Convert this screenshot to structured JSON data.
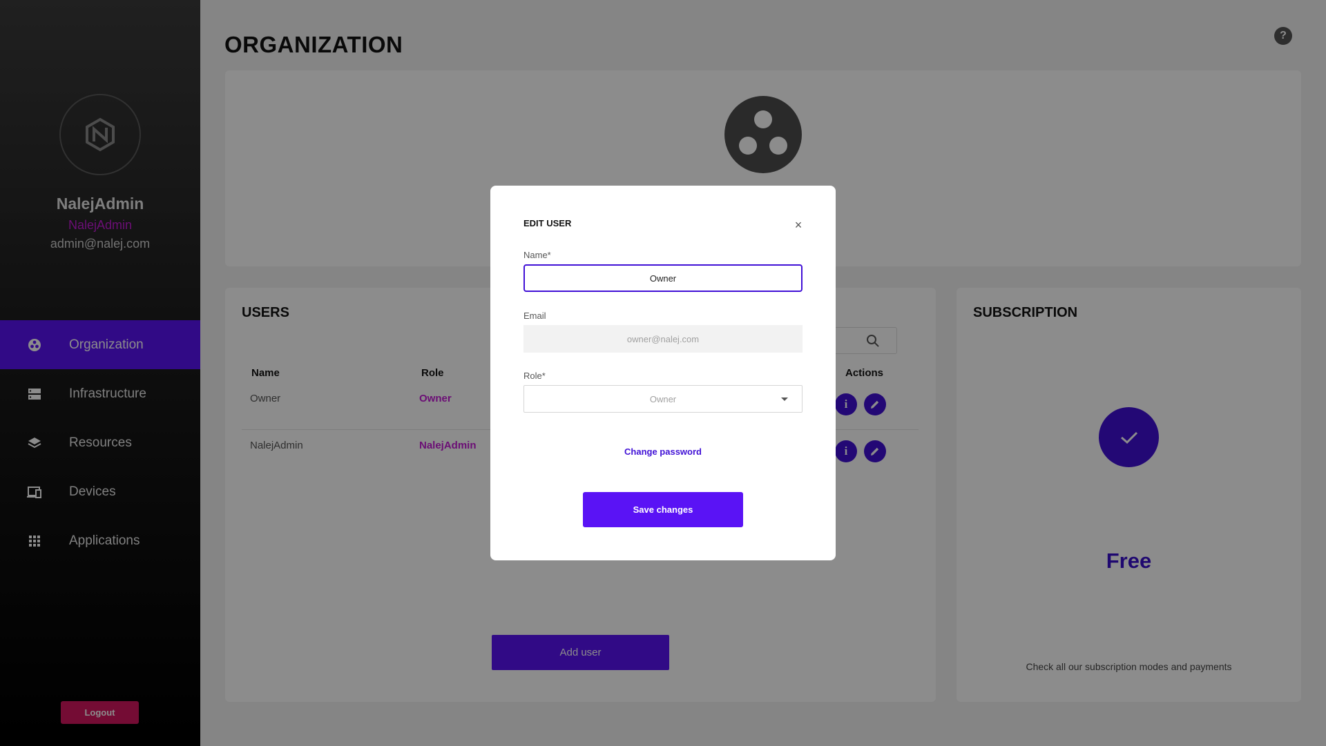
{
  "page": {
    "title": "ORGANIZATION",
    "help_icon": "?"
  },
  "sidebar": {
    "logo_icon": "nalej-logo-icon",
    "username": "NalejAdmin",
    "organization": "NalejAdmin",
    "email": "admin@nalej.com",
    "nav": [
      {
        "label": "Organization",
        "icon": "organization-icon",
        "active": true
      },
      {
        "label": "Infrastructure",
        "icon": "server-icon",
        "active": false
      },
      {
        "label": "Resources",
        "icon": "layers-icon",
        "active": false
      },
      {
        "label": "Devices",
        "icon": "devices-icon",
        "active": false
      },
      {
        "label": "Applications",
        "icon": "apps-grid-icon",
        "active": false
      }
    ],
    "logout_label": "Logout"
  },
  "users": {
    "title": "USERS",
    "columns": {
      "name": "Name",
      "role": "Role",
      "actions": "Actions"
    },
    "rows": [
      {
        "name": "Owner",
        "role": "Owner"
      },
      {
        "name": "NalejAdmin",
        "role": "NalejAdmin"
      }
    ],
    "info_glyph": "i",
    "add_user_label": "Add user"
  },
  "subscription": {
    "title": "SUBSCRIPTION",
    "plan": "Free",
    "note": "Check all our subscription modes and payments"
  },
  "modal": {
    "title": "EDIT USER",
    "close_glyph": "×",
    "name_label": "Name*",
    "name_value": "Owner",
    "email_label": "Email",
    "email_placeholder": "owner@nalej.com",
    "role_label": "Role*",
    "role_value": "Owner",
    "change_password_label": "Change password",
    "save_label": "Save changes"
  },
  "colors": {
    "accent": "#5a13f5",
    "accent_dark": "#4010d6",
    "role_text": "#c41ad6",
    "logout": "#d3175f"
  }
}
